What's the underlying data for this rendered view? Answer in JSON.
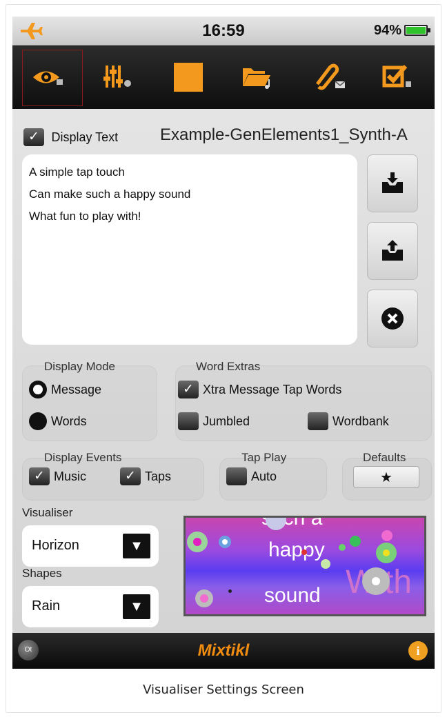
{
  "status_bar": {
    "time": "16:59",
    "battery_percent": "94%"
  },
  "toolbar": {
    "icons": [
      "eye-icon",
      "mixer-icon",
      "stop-icon",
      "folder-music-icon",
      "attach-mail-icon",
      "checkbox-music-icon"
    ],
    "active_index": 0,
    "accent_color": "#f39a1e"
  },
  "editor": {
    "display_text_label": "Display Text",
    "display_text_checked": true,
    "filename": "Example-GenElements1_Synth-A",
    "text_lines": [
      "A simple tap touch",
      "Can make such a happy sound",
      "What fun to play with!"
    ]
  },
  "display_mode": {
    "title": "Display Mode",
    "options": [
      {
        "label": "Message",
        "selected": true
      },
      {
        "label": "Words",
        "selected": false
      }
    ]
  },
  "word_extras": {
    "title": "Word Extras",
    "xtra_label": "Xtra Message Tap Words",
    "xtra_checked": true,
    "jumbled_label": "Jumbled",
    "jumbled_checked": false,
    "wordbank_label": "Wordbank",
    "wordbank_checked": false
  },
  "display_events": {
    "title": "Display Events",
    "music_label": "Music",
    "music_checked": true,
    "taps_label": "Taps",
    "taps_checked": true
  },
  "tap_play": {
    "title": "Tap Play",
    "auto_label": "Auto",
    "auto_checked": false
  },
  "defaults": {
    "title": "Defaults",
    "button_label": "★"
  },
  "visualiser": {
    "label": "Visualiser",
    "value": "Horizon"
  },
  "shapes": {
    "label": "Shapes",
    "value": "Rain"
  },
  "preview": {
    "words": [
      "such a",
      "happy",
      "sound",
      "With"
    ]
  },
  "bottom_bar": {
    "app_name": "Mixtikl",
    "left_badge": "Ot",
    "info": "i"
  },
  "caption": "Visualiser Settings Screen"
}
